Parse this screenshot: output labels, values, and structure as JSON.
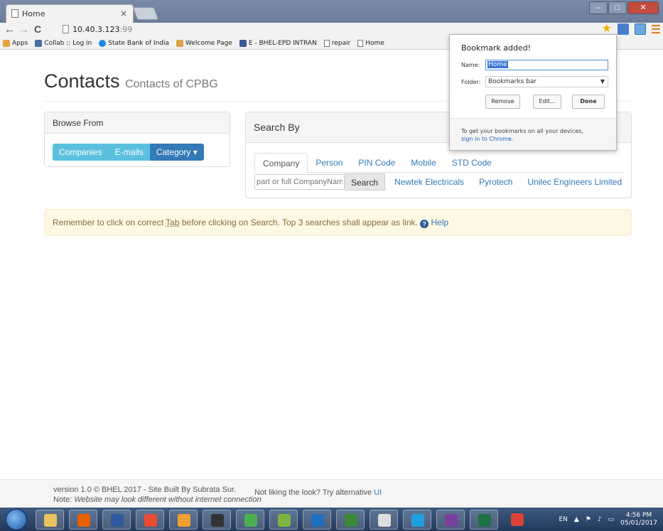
{
  "browser": {
    "tab_title": "Home",
    "tab_close": "×",
    "url_host": "10.40.3.123",
    "url_port": ":99",
    "bookmarks": [
      {
        "label": "Apps",
        "icon": "apps-grid-icon",
        "color": "#e8a33b"
      },
      {
        "label": "Collab :: Log in",
        "icon": "mail-icon",
        "color": "#4a6fa5"
      },
      {
        "label": "State Bank of India",
        "icon": "sbi-icon",
        "color": "#1e88e5"
      },
      {
        "label": "Welcome Page",
        "icon": "welcome-icon",
        "color": "#d9a441"
      },
      {
        "label": "E - BHEL-EPD INTRAN",
        "icon": "intranet-icon",
        "color": "#3b5998"
      },
      {
        "label": "repair",
        "icon": "page-icon",
        "color": "#888888"
      },
      {
        "label": "Home",
        "icon": "page-icon",
        "color": "#888888"
      }
    ]
  },
  "header": {
    "title": "Contacts",
    "subtitle": "Contacts of CPBG"
  },
  "browse": {
    "heading": "Browse From",
    "buttons": [
      "Companies",
      "E-mails",
      "Category ▾"
    ]
  },
  "search": {
    "heading": "Search By",
    "tabs": [
      "Company",
      "Person",
      "PIN Code",
      "Mobile",
      "STD Code"
    ],
    "active_tab": "Company",
    "input_placeholder": "part or full CompanyName",
    "button_label": "Search",
    "quick_links": [
      "Newtek Electricals",
      "Pyrotech",
      "Unilec Engineers Limited"
    ]
  },
  "alert": {
    "text_before": "Remember to click on correct ",
    "tab_word": "Tab",
    "text_after": " before clicking on Search. Top 3 searches shall appear as link. ",
    "help_label": "Help"
  },
  "footer": {
    "line1": "version 1.0 © BHEL 2017 - Site Built By Subrata Sur.",
    "note_label": "Note: ",
    "note_text": "Website may look different without internet connection",
    "alt_text": "Not liking the look? Try alternative ",
    "alt_link": "UI"
  },
  "bookmark_popup": {
    "title": "Bookmark added!",
    "name_label": "Name:",
    "name_value": "Home",
    "folder_label": "Folder:",
    "folder_value": "Bookmarks bar",
    "remove": "Remove",
    "edit": "Edit...",
    "done": "Done",
    "sync_text": "To get your bookmarks on all your devices,",
    "sync_link": "sign in to Chrome."
  },
  "taskbar": {
    "apps": [
      {
        "icon": "explorer-icon",
        "color": "#e8c25a"
      },
      {
        "icon": "firefox-icon",
        "color": "#e66000"
      },
      {
        "icon": "powershell-icon",
        "color": "#2d5a9e"
      },
      {
        "icon": "git-icon",
        "color": "#e84d31"
      },
      {
        "icon": "hs-icon",
        "color": "#f0a030"
      },
      {
        "icon": "terminal-icon",
        "color": "#333333"
      },
      {
        "icon": "media-icon",
        "color": "#4caf50"
      },
      {
        "icon": "android-icon",
        "color": "#7cb342"
      },
      {
        "icon": "outlook-icon",
        "color": "#1e6fc0"
      },
      {
        "icon": "project-icon",
        "color": "#3a8a3a"
      },
      {
        "icon": "tex-icon",
        "color": "#dddddd"
      },
      {
        "icon": "ie-icon",
        "color": "#1ea0e0"
      },
      {
        "icon": "onenote-icon",
        "color": "#7b3f9e"
      },
      {
        "icon": "excel-icon",
        "color": "#1e7145"
      },
      {
        "icon": "chrome-icon",
        "color": "#db4437"
      }
    ],
    "lang": "EN",
    "time": "4:56 PM",
    "date": "05/01/2017"
  }
}
